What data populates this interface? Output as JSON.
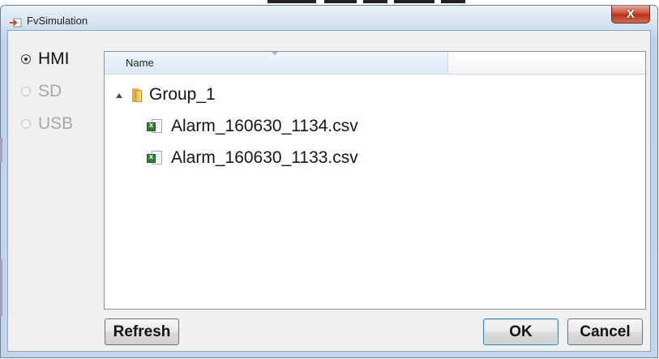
{
  "window": {
    "title": "FvSimulation",
    "close_glyph": "X"
  },
  "storage": {
    "options": [
      {
        "label": "HMI",
        "selected": true
      },
      {
        "label": "SD",
        "selected": false
      },
      {
        "label": "USB",
        "selected": false
      }
    ]
  },
  "file_list": {
    "columns": [
      "Name"
    ],
    "tree": {
      "folder": "Group_1",
      "files": [
        "Alarm_160630_1134.csv",
        "Alarm_160630_1133.csv"
      ]
    }
  },
  "buttons": {
    "refresh": "Refresh",
    "ok": "OK",
    "cancel": "Cancel"
  },
  "icons": {
    "app": "app-icon",
    "close": "close-icon",
    "expander": "expander-icon",
    "folder": "folder-icon",
    "file": "excel-file-icon"
  },
  "colors": {
    "titlebar": "#bcd2ea",
    "close": "#c8442a",
    "client": "#f0f0f0",
    "default_button_border": "#3c7fb1"
  }
}
